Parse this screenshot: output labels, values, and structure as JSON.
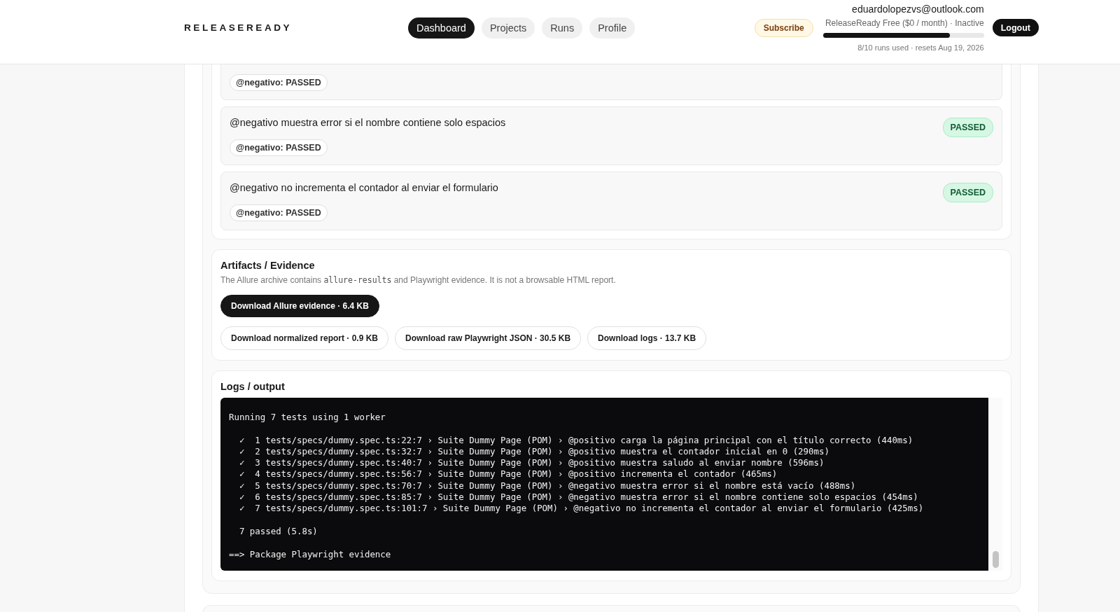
{
  "header": {
    "logo": "RELEASEREADY",
    "nav": [
      {
        "label": "Dashboard",
        "selected": true
      },
      {
        "label": "Projects",
        "selected": false
      },
      {
        "label": "Runs",
        "selected": false
      },
      {
        "label": "Profile",
        "selected": false
      }
    ],
    "subscribe": "Subscribe",
    "account": {
      "email": "eduardolopezvs@outlook.com",
      "plan": "ReleaseReady Free ($0 / month) · Inactive",
      "level": 0.79,
      "usage": "8/10 runs used · resets Aug 19, 2026"
    },
    "logout": "Logout"
  },
  "tests": [
    {
      "tag": "@negativo: PASSED"
    },
    {
      "title": "@negativo muestra error si el nombre contiene solo espacios",
      "tag": "@negativo: PASSED",
      "badge": {
        "label": "PASSED",
        "kind": "success"
      }
    },
    {
      "title": "@negativo no incrementa el contador al enviar el formulario",
      "tag": "@negativo: PASSED",
      "badge": {
        "label": "PASSED",
        "kind": "success"
      }
    }
  ],
  "artifacts": {
    "title": "Artifacts / Evidence",
    "description": {
      "before": "The Allure archive contains ",
      "code": "allure-results",
      "after": " and Playwright evidence. It is not a browsable HTML report."
    },
    "buttons": [
      {
        "label": "Download Allure evidence · 6.4 KB",
        "kind": "primary"
      },
      {
        "label": "Download normalized report · 0.9 KB",
        "kind": "secondary"
      },
      {
        "label": "Download raw Playwright JSON · 30.5 KB",
        "kind": "secondary"
      },
      {
        "label": "Download logs · 13.7 KB",
        "kind": "secondary"
      }
    ]
  },
  "logs": {
    "title": "Logs / output",
    "blocks": [
      [
        "Running 7 tests using 1 worker"
      ],
      [
        "  ✓  1 tests/specs/dummy.spec.ts:22:7 › Suite Dummy Page (POM) › @positivo carga la página principal con el título correcto (440ms)",
        "  ✓  2 tests/specs/dummy.spec.ts:32:7 › Suite Dummy Page (POM) › @positivo muestra el contador inicial en 0 (290ms)",
        "  ✓  3 tests/specs/dummy.spec.ts:40:7 › Suite Dummy Page (POM) › @positivo muestra saludo al enviar nombre (596ms)",
        "  ✓  4 tests/specs/dummy.spec.ts:56:7 › Suite Dummy Page (POM) › @positivo incrementa el contador (465ms)",
        "  ✓  5 tests/specs/dummy.spec.ts:70:7 › Suite Dummy Page (POM) › @negativo muestra error si el nombre está vacío (488ms)",
        "  ✓  6 tests/specs/dummy.spec.ts:85:7 › Suite Dummy Page (POM) › @negativo muestra error si el nombre contiene solo espacios (454ms)",
        "  ✓  7 tests/specs/dummy.spec.ts:101:7 › Suite Dummy Page (POM) › @negativo no incrementa el contador al enviar el formulario (425ms)"
      ],
      [
        "  7 passed (5.8s)"
      ],
      [
        "==> Package Playwright evidence"
      ]
    ]
  }
}
